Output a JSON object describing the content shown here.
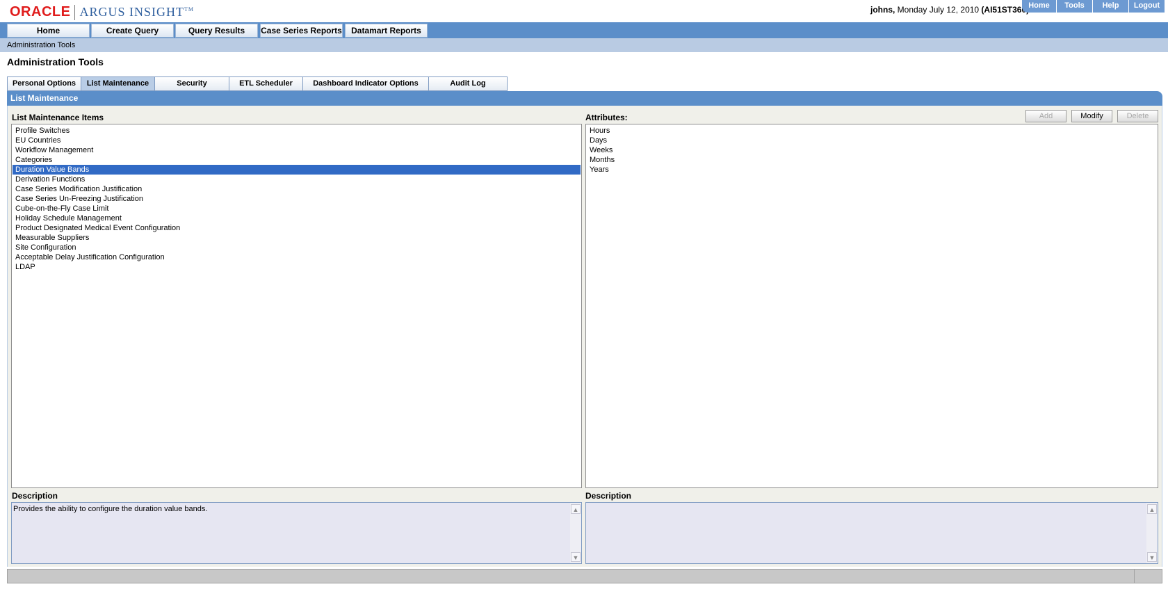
{
  "header": {
    "logo_oracle": "ORACLE",
    "logo_argus": "ARGUS INSIGHT",
    "logo_tm": "TM",
    "user": "johns,",
    "date": " Monday July 12, 2010 ",
    "server": "(AI51ST360)",
    "links": [
      "Home",
      "Tools",
      "Help",
      "Logout"
    ]
  },
  "nav": {
    "items": [
      "Home",
      "Create Query",
      "Query Results",
      "Case Series Reports",
      "Datamart Reports"
    ]
  },
  "breadcrumb": "Administration Tools",
  "page_title": "Administration Tools",
  "tabs": {
    "items": [
      "Personal Options",
      "List Maintenance",
      "Security",
      "ETL Scheduler",
      "Dashboard Indicator Options",
      "Audit Log"
    ],
    "active": "List Maintenance"
  },
  "section": {
    "title": "List Maintenance",
    "items_label": "List Maintenance Items",
    "attributes_label": "Attributes:",
    "items": [
      "Profile Switches",
      "EU Countries",
      "Workflow Management",
      "Categories",
      "Duration Value Bands",
      "Derivation Functions",
      "Case Series Modification Justification",
      "Case Series Un-Freezing Justification",
      "Cube-on-the-Fly Case Limit",
      "Holiday Schedule Management",
      "Product Designated Medical Event Configuration",
      "Measurable Suppliers",
      "Site Configuration",
      "Acceptable Delay Justification Configuration",
      "LDAP"
    ],
    "selected_item": "Duration Value Bands",
    "attributes": [
      "Hours",
      "Days",
      "Weeks",
      "Months",
      "Years"
    ],
    "buttons": {
      "add": "Add",
      "modify": "Modify",
      "delete": "Delete"
    },
    "left_desc_label": "Description",
    "right_desc_label": "Description",
    "left_desc": "Provides the ability to configure the duration value bands.",
    "right_desc": ""
  },
  "icons": {
    "scroll_up": "▲",
    "scroll_down": "▼"
  }
}
